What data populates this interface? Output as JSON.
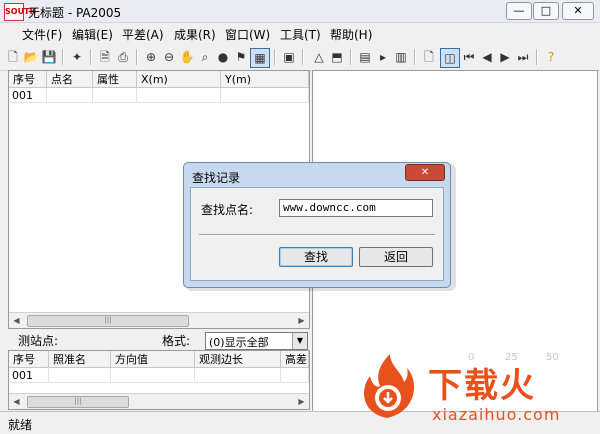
{
  "window": {
    "title": "无标题 - PA2005",
    "logo_text": "SOUTH"
  },
  "menu": [
    {
      "label": "文件(F)"
    },
    {
      "label": "编辑(E)"
    },
    {
      "label": "平差(A)"
    },
    {
      "label": "成果(R)"
    },
    {
      "label": "窗口(W)"
    },
    {
      "label": "工具(T)"
    },
    {
      "label": "帮助(H)"
    }
  ],
  "upper_table": {
    "columns": [
      "序号",
      "点名",
      "属性",
      "X(m)",
      "Y(m)"
    ],
    "rows": [
      [
        "001",
        "",
        "",
        "",
        ""
      ]
    ]
  },
  "station": {
    "label": "测站点:",
    "format_label": "格式:",
    "format_value": "(0)显示全部"
  },
  "lower_table": {
    "columns": [
      "序号",
      "照准名",
      "方向值",
      "观测边长",
      "高差"
    ],
    "rows": [
      [
        "001",
        "",
        "",
        "",
        ""
      ]
    ]
  },
  "dialog": {
    "title": "查找记录",
    "label": "查找点名:",
    "input_value": "www.downcc.com",
    "find_label": "查找",
    "return_label": "返回"
  },
  "status": "就绪",
  "watermark": {
    "scale": [
      "0",
      "25",
      "50"
    ],
    "text": "下载火",
    "site": "xiazaihuo.com",
    "color": "#e8501c"
  }
}
